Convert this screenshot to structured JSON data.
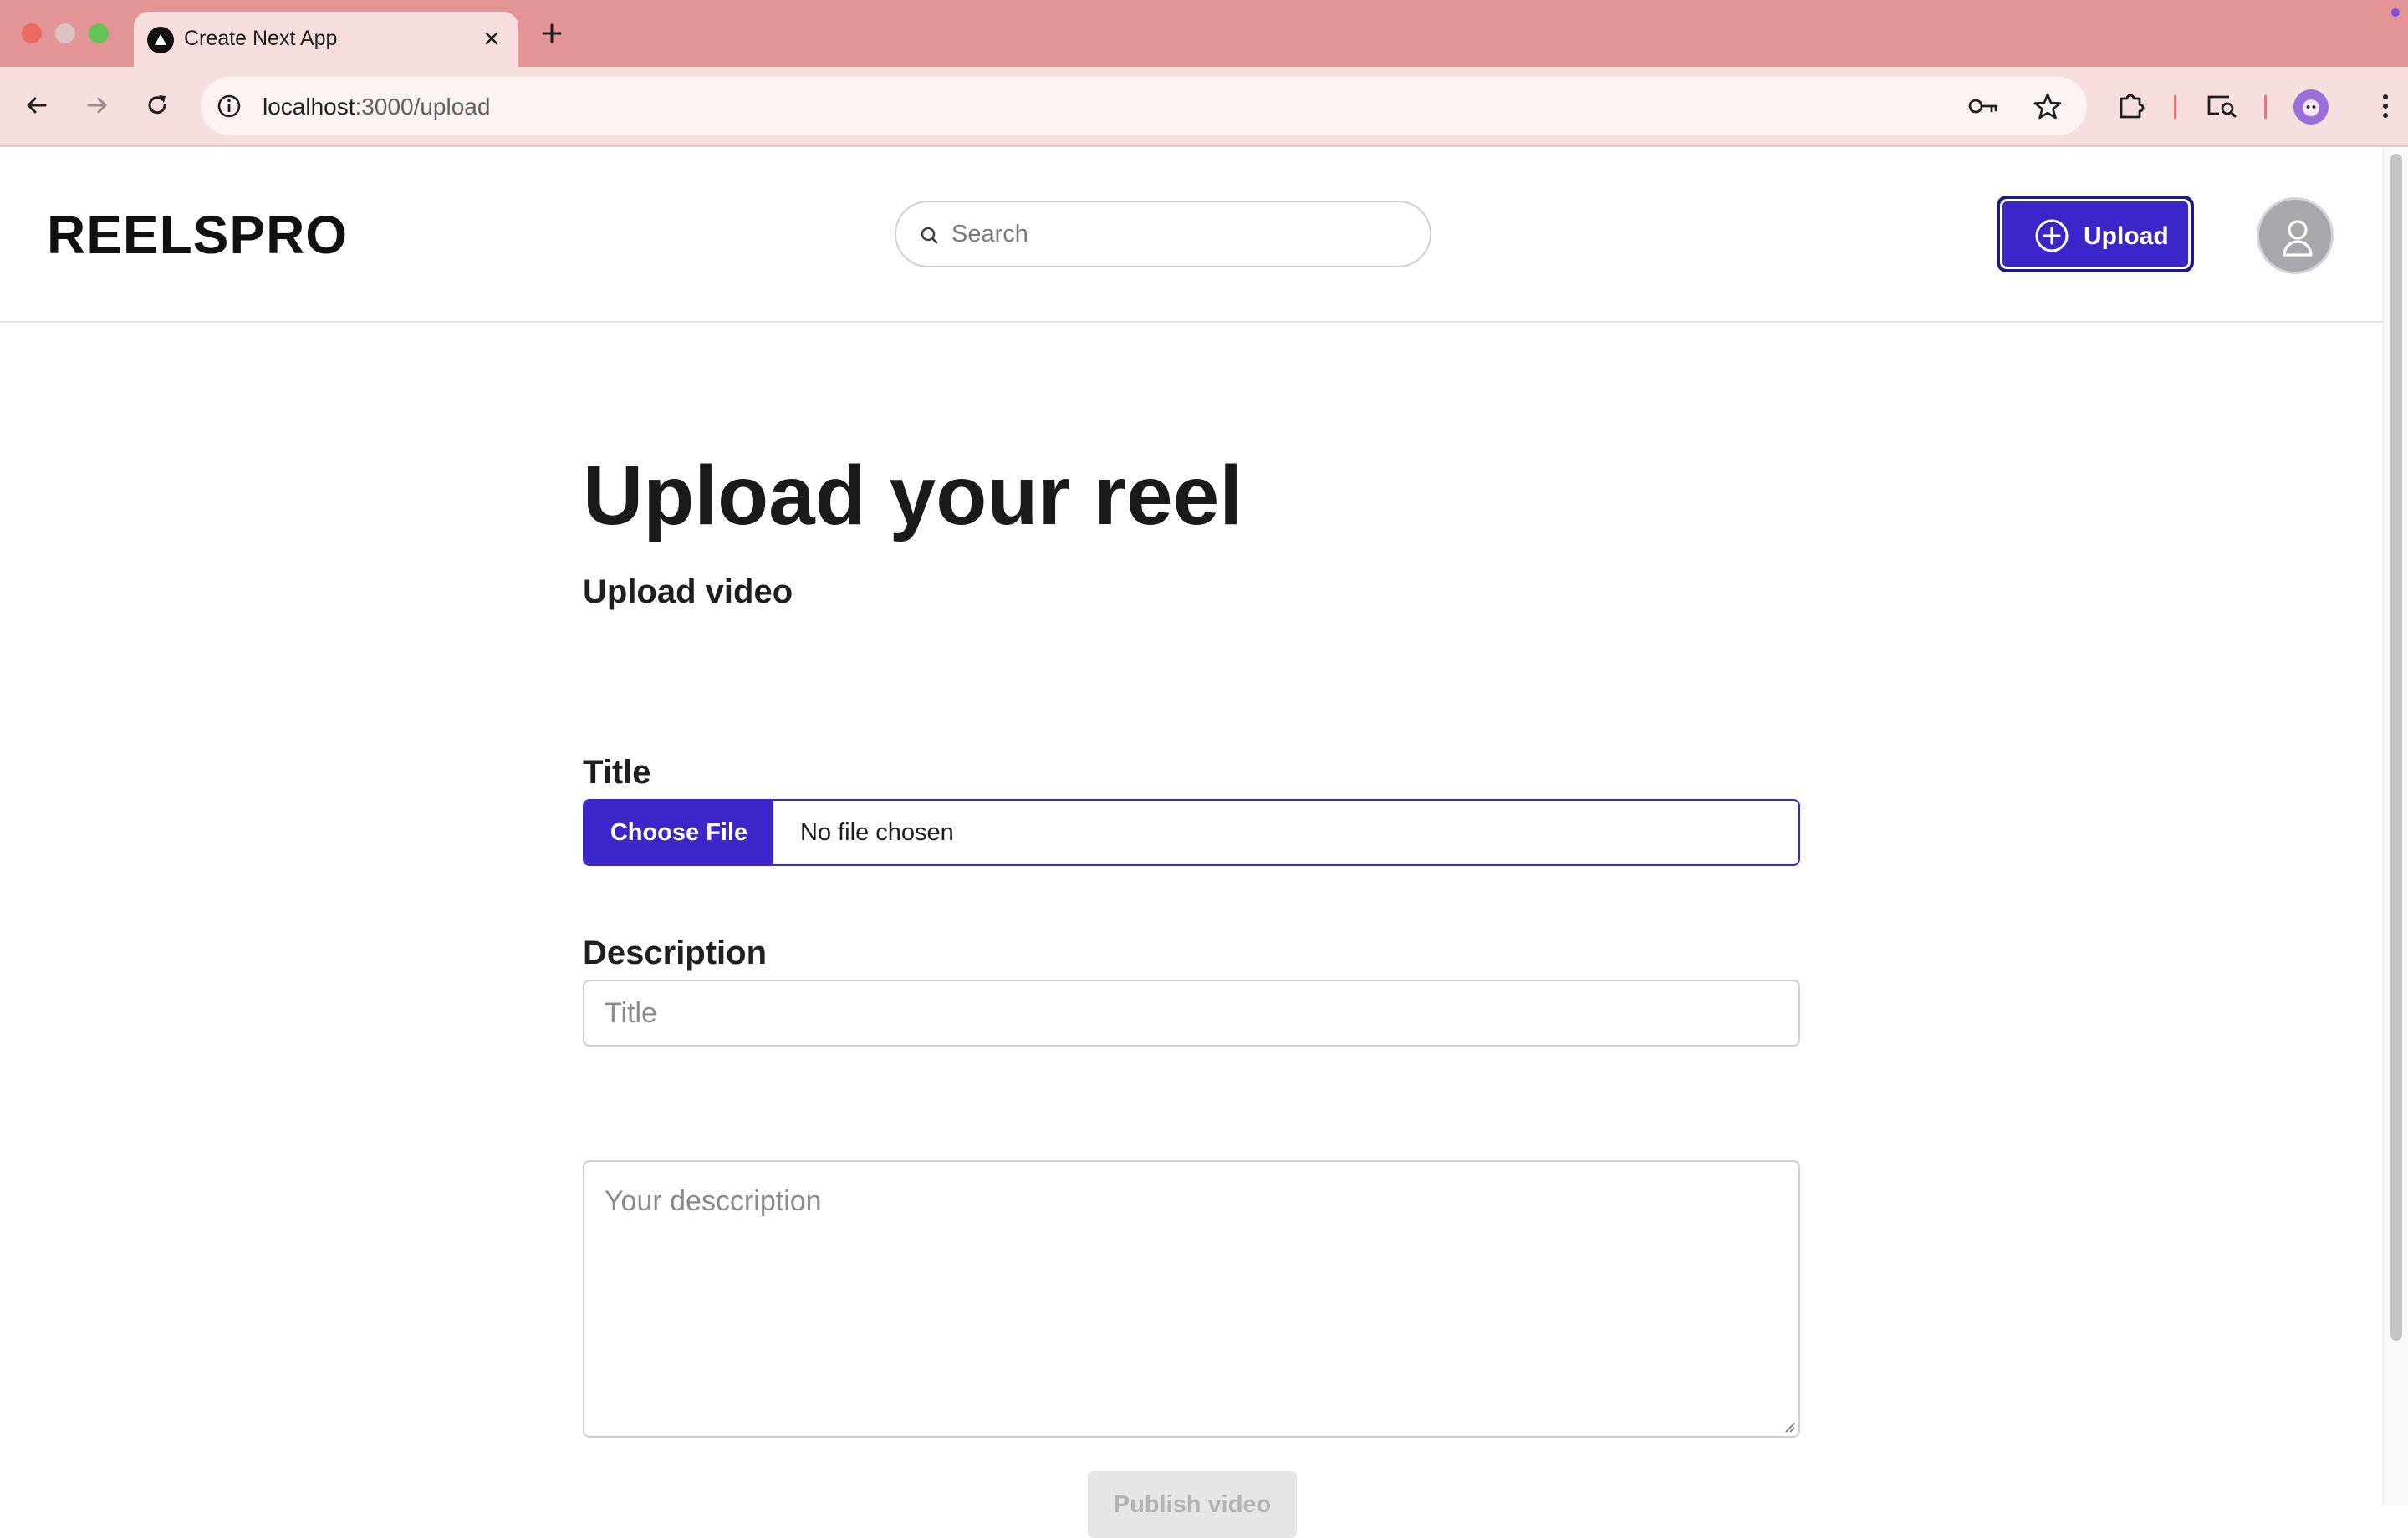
{
  "browser": {
    "tab_title": "Create Next App",
    "url_host": "localhost",
    "url_path": ":3000/upload"
  },
  "app": {
    "brand": "REELSPRO",
    "search": {
      "placeholder": "Search"
    },
    "upload_button_label": "Upload"
  },
  "form": {
    "heading": "Upload your reel",
    "video_label": "Upload video",
    "choose_file_label": "Choose File",
    "file_status": "No file chosen",
    "title_label": "Title",
    "title_placeholder": "Title",
    "description_label": "Description",
    "description_placeholder": "Your desccription",
    "publish_label": "Publish video"
  },
  "colors": {
    "accent": "#3b27c9",
    "tab_bar": "#e39497",
    "toolbar": "#f7dfe0",
    "disabled_button": "#e6e6e6"
  },
  "icons": {
    "tab": [
      "nextjs-favicon-icon",
      "close-icon",
      "plus-icon"
    ],
    "toolbar": [
      "back-arrow-icon",
      "forward-arrow-icon",
      "reload-icon",
      "site-info-icon",
      "key-icon",
      "star-icon",
      "extensions-icon",
      "cast-search-icon",
      "profile-icon",
      "kebab-menu-icon"
    ],
    "page": [
      "search-icon",
      "plus-circle-icon",
      "user-icon"
    ]
  }
}
